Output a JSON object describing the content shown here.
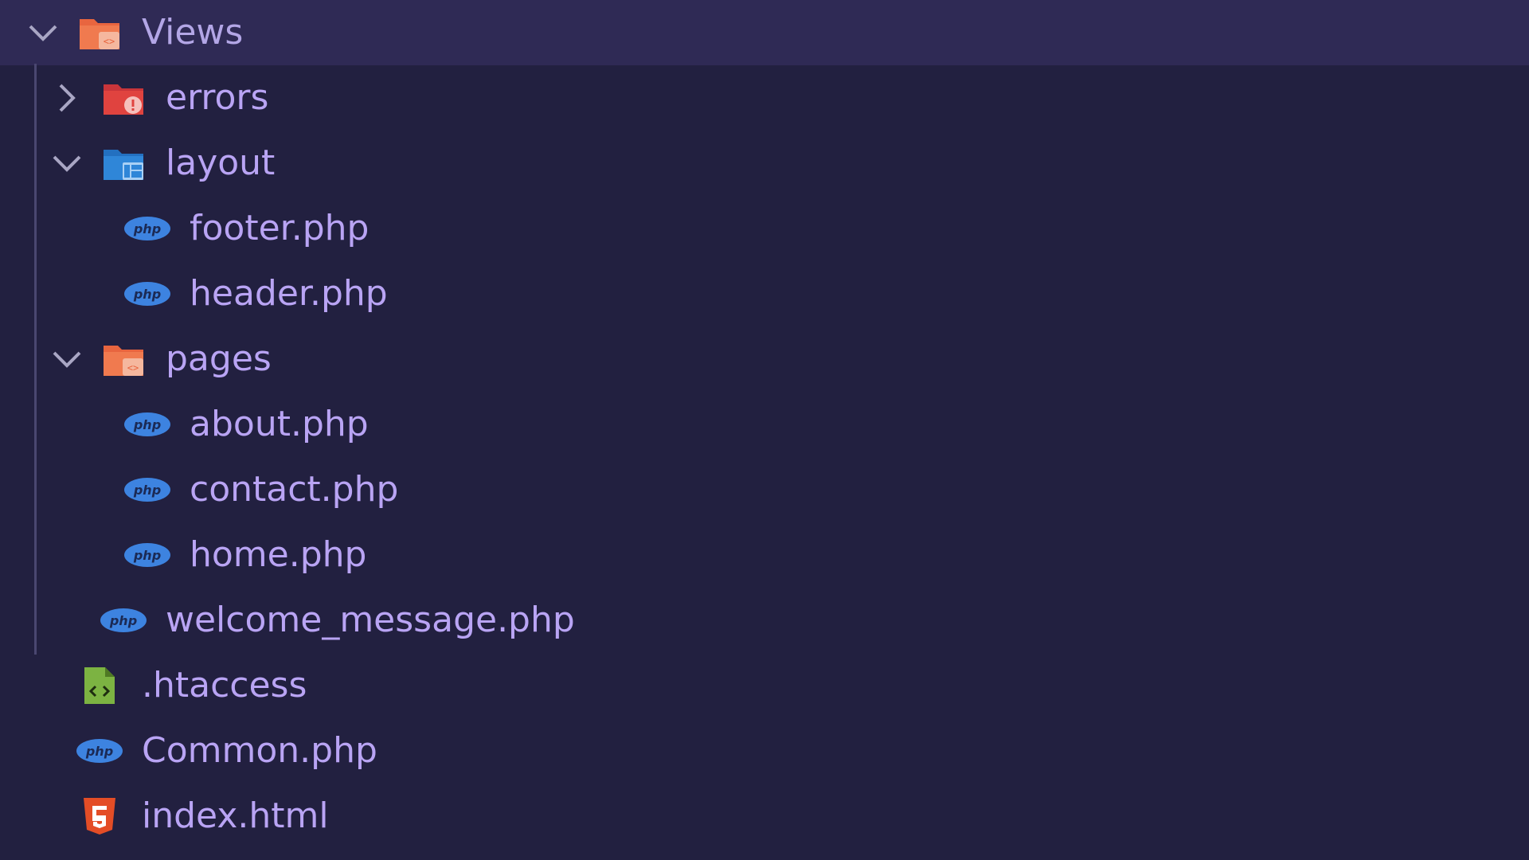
{
  "explorer": {
    "root": {
      "label": "Views",
      "expanded": true,
      "icon": "views-folder-icon"
    },
    "items": [
      {
        "label": "errors",
        "type": "folder",
        "expanded": false,
        "icon": "errors-folder-icon"
      },
      {
        "label": "layout",
        "type": "folder",
        "expanded": true,
        "icon": "layout-folder-icon"
      },
      {
        "label": "footer.php",
        "type": "file",
        "icon": "php-icon"
      },
      {
        "label": "header.php",
        "type": "file",
        "icon": "php-icon"
      },
      {
        "label": "pages",
        "type": "folder",
        "expanded": true,
        "icon": "pages-folder-icon"
      },
      {
        "label": "about.php",
        "type": "file",
        "icon": "php-icon"
      },
      {
        "label": "contact.php",
        "type": "file",
        "icon": "php-icon"
      },
      {
        "label": "home.php",
        "type": "file",
        "icon": "php-icon"
      },
      {
        "label": "welcome_message.php",
        "type": "file",
        "icon": "php-icon"
      },
      {
        "label": ".htaccess",
        "type": "file",
        "icon": "htaccess-icon"
      },
      {
        "label": "Common.php",
        "type": "file",
        "icon": "php-icon"
      },
      {
        "label": "index.html",
        "type": "file",
        "icon": "html5-icon"
      }
    ]
  },
  "colors": {
    "background": "#222040",
    "selected_row": "#2f2a55",
    "text": "#b9a4f4",
    "php_blue": "#3d83e0",
    "folder_orange": "#e8653f",
    "folder_red": "#e0433f",
    "folder_blue": "#2f86d8",
    "htaccess_green": "#7cb342",
    "html_orange": "#e44d26"
  }
}
